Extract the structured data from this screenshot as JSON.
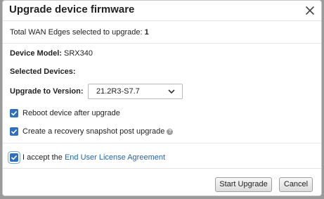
{
  "dialog": {
    "title": "Upgrade device firmware"
  },
  "summary": {
    "label": "Total WAN Edges selected to upgrade: ",
    "count": "1"
  },
  "device": {
    "model_label": "Device Model:",
    "model_value": " SRX340",
    "selected_devices_label": "Selected Devices:"
  },
  "version": {
    "label": "Upgrade to Version:",
    "selected": "21.2R3-S7.7"
  },
  "options": {
    "reboot_label": "Reboot device after upgrade",
    "reboot_checked": true,
    "snapshot_label": "Create a recovery snapshot post upgrade",
    "snapshot_checked": true
  },
  "eula": {
    "prefix": "I accept the ",
    "link_text": "End User License Agreement",
    "checked": true
  },
  "footer": {
    "start_label": "Start Upgrade",
    "cancel_label": "Cancel"
  },
  "colors": {
    "accent": "#2f6fc0",
    "link": "#1d64b5"
  },
  "icons": {
    "close": "close-icon",
    "chevron": "chevron-down-icon",
    "help": "help-icon",
    "check": "check-icon"
  }
}
